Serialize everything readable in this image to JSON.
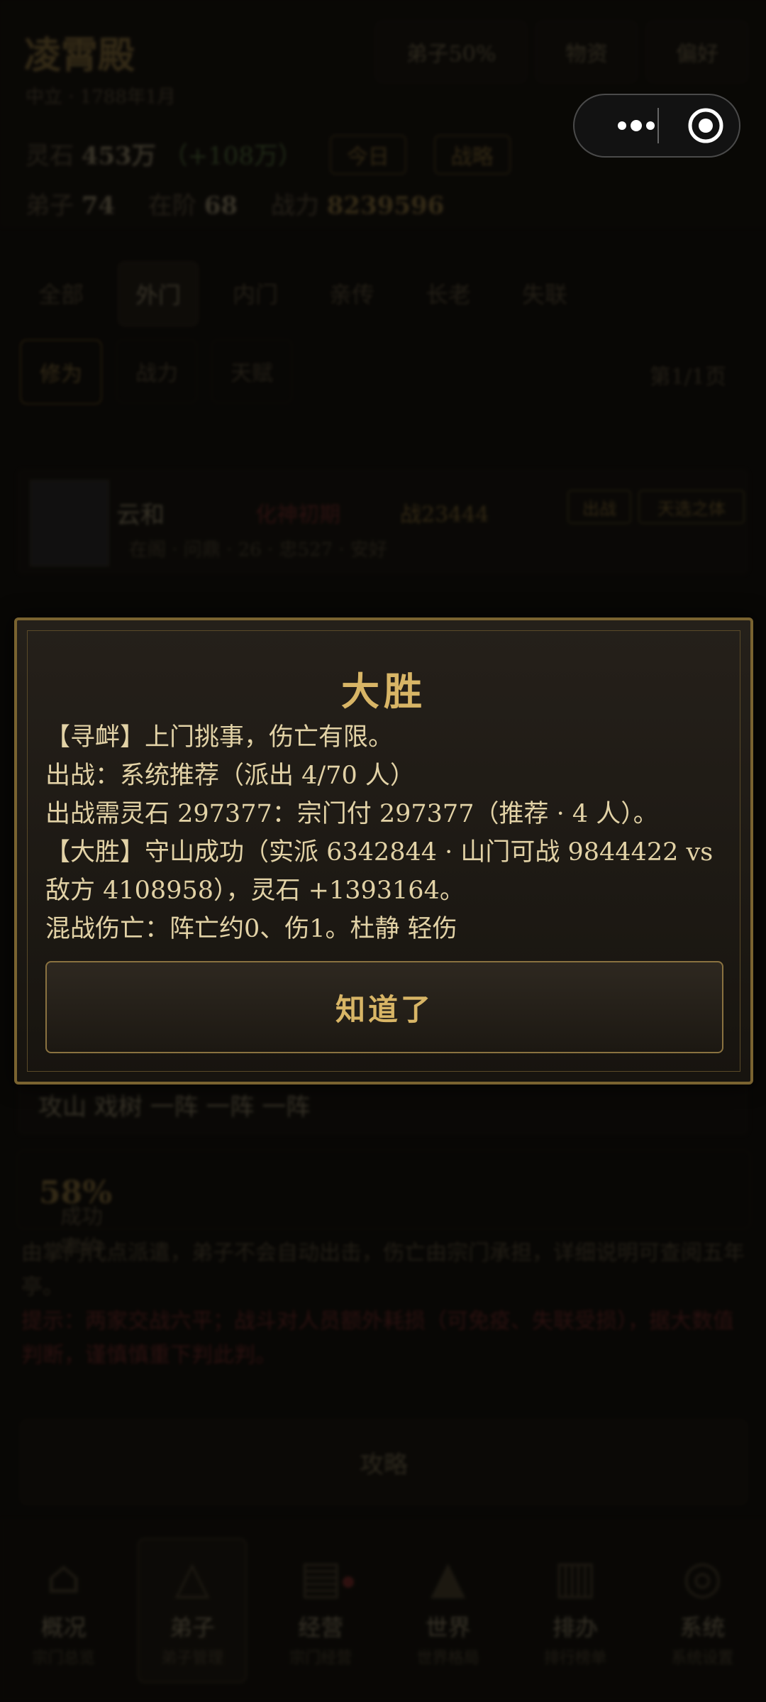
{
  "background": {
    "sect_name": "凌霄殿",
    "sect_sub": "中立 · 1788年1月",
    "top_buttons": [
      "弟子50%",
      "物资",
      "偏好"
    ],
    "resources": {
      "label": "灵石",
      "value": "453万",
      "delta": "（+108万）",
      "pill1": "今日",
      "pill2": "战略"
    },
    "stats": {
      "disciples_label": "弟子",
      "disciples": "74",
      "standing_label": "在阶",
      "standing": "68",
      "power_label": "战力",
      "power": "8239596"
    },
    "tabs": [
      "全部",
      "外门",
      "内门",
      "亲传",
      "长老",
      "失联"
    ],
    "chips": [
      "修为",
      "战力",
      "天赋"
    ],
    "count": "第1/1页",
    "row": {
      "name": "云和",
      "status": "化神初期",
      "power": "战23444",
      "sub": "在阁 · 问鼎 · 26 · 忠527 · 安好",
      "tag1": "出战",
      "tag2": "天选之体"
    },
    "section2": "攻山 戏树 一阵 一阵 一阵",
    "rate": {
      "label": "成功率约",
      "value": "58%"
    },
    "hint1": "由掌门代点派遣，弟子不会自动出击，伤亡由宗门承担，详细说明可查阅五年亭。",
    "hint2": "提示：两家交战六平；战斗对人员额外耗损（可免疫、失联受损），据大数值判断，谨慎慎重下判此判。",
    "big_button": "攻略",
    "nav": [
      {
        "label": "概况",
        "sub": "宗门总览"
      },
      {
        "label": "弟子",
        "sub": "弟子管理"
      },
      {
        "label": "经营",
        "sub": "宗门经营"
      },
      {
        "label": "世界",
        "sub": "世界格局"
      },
      {
        "label": "排办",
        "sub": "排行榜单"
      },
      {
        "label": "系统",
        "sub": "系统设置"
      }
    ]
  },
  "modal": {
    "title": "大胜",
    "lines": [
      "【寻衅】上门挑事，伤亡有限。",
      "出战：系统推荐（派出 4/70 人）",
      "出战需灵石 297377：宗门付 297377（推荐 · 4 人）。",
      "【大胜】守山成功（实派 6342844 · 山门可战 9844422 vs 敌方 4108958），灵石 +1393164。",
      "混战伤亡：阵亡约0、伤1。杜静 轻伤"
    ],
    "button": "知道了"
  }
}
